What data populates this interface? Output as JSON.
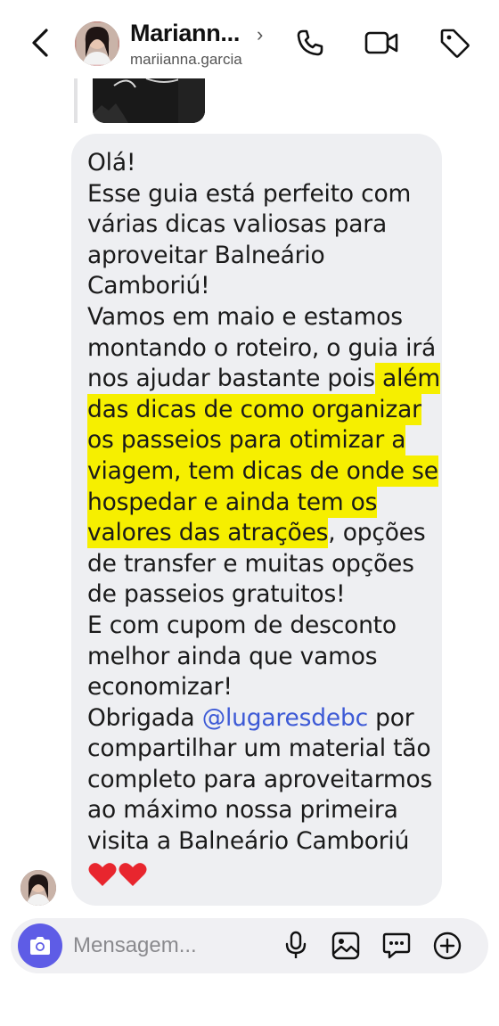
{
  "header": {
    "contact_name": "Mariann...",
    "chevron": "›",
    "username": "mariianna.garcia",
    "icons": [
      "back-icon",
      "phone-icon",
      "video-icon",
      "tag-icon"
    ]
  },
  "message": {
    "lines": [
      {
        "segments": [
          {
            "text": "Olá!"
          }
        ]
      },
      {
        "segments": [
          {
            "text": "Esse guia está perfeito com"
          }
        ]
      },
      {
        "segments": [
          {
            "text": "várias dicas valiosas para"
          }
        ]
      },
      {
        "segments": [
          {
            "text": "aproveitar Balneário"
          }
        ]
      },
      {
        "segments": [
          {
            "text": "Camboriú!"
          }
        ]
      },
      {
        "segments": [
          {
            "text": "Vamos em maio e estamos"
          }
        ]
      },
      {
        "segments": [
          {
            "text": "montando o roteiro, o guia irá"
          }
        ]
      },
      {
        "segments": [
          {
            "text": "nos ajudar bastante pois"
          },
          {
            "text": " além",
            "hl": true
          }
        ]
      },
      {
        "segments": [
          {
            "text": "das dicas de como organizar",
            "hl": true
          }
        ]
      },
      {
        "segments": [
          {
            "text": "os passeios para otimizar a",
            "hl": true
          }
        ]
      },
      {
        "segments": [
          {
            "text": "viagem, tem dicas de onde se",
            "hl": true
          }
        ]
      },
      {
        "segments": [
          {
            "text": "hospedar e ainda tem os",
            "hl": true
          }
        ]
      },
      {
        "segments": [
          {
            "text": "valores das atrações",
            "hl": true
          },
          {
            "text": ", opções"
          }
        ]
      },
      {
        "segments": [
          {
            "text": "de transfer e muitas opções"
          }
        ]
      },
      {
        "segments": [
          {
            "text": "de passeios gratuitos!"
          }
        ]
      },
      {
        "segments": [
          {
            "text": "E com cupom de desconto"
          }
        ]
      },
      {
        "segments": [
          {
            "text": "melhor ainda que vamos"
          }
        ]
      },
      {
        "segments": [
          {
            "text": "economizar!"
          }
        ]
      },
      {
        "segments": [
          {
            "text": "Obrigada "
          },
          {
            "text": "@lugaresdebc",
            "mention": true
          },
          {
            "text": " por"
          }
        ]
      },
      {
        "segments": [
          {
            "text": "compartilhar um material tão"
          }
        ]
      },
      {
        "segments": [
          {
            "text": "completo para aproveitarmos"
          }
        ]
      },
      {
        "segments": [
          {
            "text": "ao máximo nossa primeira"
          }
        ]
      },
      {
        "segments": [
          {
            "text": "visita a Balneário Camboriú"
          }
        ]
      }
    ],
    "hearts": 2,
    "highlight_color": "#f6ef00",
    "mention_color": "#3d5ad6"
  },
  "composer": {
    "placeholder": "Mensagem...",
    "icons": [
      "camera-icon",
      "microphone-icon",
      "gallery-icon",
      "sticker-icon",
      "add-icon"
    ],
    "accent": "#5e5ce6"
  }
}
